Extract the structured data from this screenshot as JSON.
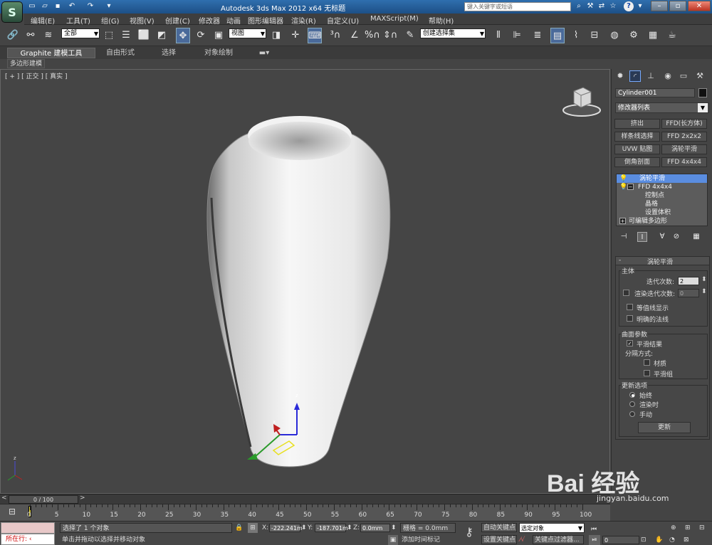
{
  "title_bar": {
    "app_title": "Autodesk 3ds Max  2012 x64     无标题",
    "search_placeholder": "键入关键字或短语",
    "help_label": "?"
  },
  "menu": {
    "items": [
      "编辑(E)",
      "工具(T)",
      "组(G)",
      "视图(V)",
      "创建(C)",
      "修改器",
      "动画",
      "图形编辑器",
      "渲染(R)",
      "自定义(U)",
      "MAXScript(M)",
      "帮助(H)"
    ]
  },
  "toolbar": {
    "selection_filter": "全部",
    "ref_coord": "视图",
    "named_selection": "创建选择集"
  },
  "ribbon": {
    "tabs": [
      "Graphite 建模工具",
      "自由形式",
      "选择",
      "对象绘制"
    ],
    "sub_tab": "多边形建模"
  },
  "viewport": {
    "label": "[ + ] [ 正交 ] [ 真实 ]"
  },
  "command_panel": {
    "object_name": "Cylinder001",
    "modifier_list": "修改器列表",
    "modifier_buttons": [
      "挤出",
      "FFD(长方体)",
      "样条线选择",
      "FFD 2x2x2",
      "UVW 贴图",
      "涡轮平滑",
      "倒角剖面",
      "FFD 4x4x4"
    ],
    "stack": {
      "item1": "涡轮平滑",
      "item2": "FFD 4x4x4",
      "sub1": "控制点",
      "sub2": "晶格",
      "sub3": "设置体积",
      "item3": "可编辑多边形"
    },
    "rollout": {
      "title": "涡轮平滑",
      "collapse": "-",
      "main_group": "主体",
      "iterations_label": "迭代次数:",
      "iterations_value": "2",
      "render_iters_label": "渲染迭代次数:",
      "render_iters_value": "0",
      "isoline_label": "等值线显示",
      "explicit_normals_label": "明确的法线",
      "surface_group": "曲面参数",
      "smooth_result_label": "平滑结果",
      "separate_label": "分隔方式:",
      "materials_label": "材质",
      "smoothing_groups_label": "平滑组",
      "update_group": "更新选项",
      "always_label": "始终",
      "when_rendering_label": "渲染时",
      "manually_label": "手动",
      "update_button": "更新"
    }
  },
  "timeline": {
    "frame_display": "0 / 100",
    "tick_labels": [
      "0",
      "5",
      "10",
      "15",
      "20",
      "25",
      "30",
      "35",
      "40",
      "45",
      "50",
      "55",
      "60",
      "65",
      "70",
      "75",
      "80",
      "85",
      "90",
      "95",
      "100"
    ]
  },
  "status": {
    "script_label": "所在行:",
    "status_text": "选择了 1 个对象",
    "prompt_text": "单击并拖动以选择并移动对象",
    "x_label": "X:",
    "x_value": "-222.241m",
    "y_label": "Y:",
    "y_value": "-187.701m",
    "z_label": "Z:",
    "z_value": "0.0mm",
    "grid": "栅格 = 0.0mm",
    "add_time_tag": "添加时间标记",
    "auto_key": "自动关键点",
    "set_key": "设置关键点",
    "selected_object": "选定对象",
    "key_filters": "关键点过滤器...",
    "frame_value": "0"
  },
  "watermark": {
    "brand": "Bai 经验",
    "url": "jingyan.baidu.com"
  }
}
